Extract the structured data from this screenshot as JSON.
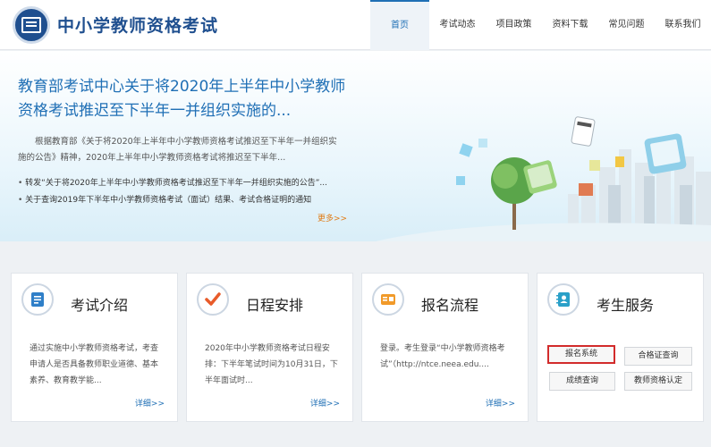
{
  "header": {
    "site_title": "中小学教师资格考试",
    "nav": [
      "首页",
      "考试动态",
      "项目政策",
      "资料下载",
      "常见问题",
      "联系我们"
    ]
  },
  "banner": {
    "headline": "教育部考试中心关于将2020年上半年中小学教师资格考试推迟至下半年一并组织实施的...",
    "summary": "根据教育部《关于将2020年上半年中小学教师资格考试推迟至下半年一并组织实施的公告》精神，2020年上半年中小学教师资格考试将推迟至下半年...",
    "news": [
      "转发“关于将2020年上半年中小学教师资格考试推迟至下半年一并组织实施的公告”...",
      "关于查询2019年下半年中小学教师资格考试（面试）结果、考试合格证明的通知"
    ],
    "more": "更多>>"
  },
  "cards": [
    {
      "title": "考试介绍",
      "text": "通过实施中小学教师资格考试，考查申请人是否具备教师职业道德、基本素养、教育教学能...",
      "more": "详细>>",
      "icon": "document-icon"
    },
    {
      "title": "日程安排",
      "text": "2020年中小学教师资格考试日程安排：下半年笔试时间为10月31日，下半年面试时...",
      "more": "详细>>",
      "icon": "checkmark-icon"
    },
    {
      "title": "报名流程",
      "text": "登录。考生登录“中小学教师资格考试”（http://ntce.neea.edu....",
      "more": "详细>>",
      "icon": "form-icon"
    },
    {
      "title": "考生服务",
      "icon": "contacts-icon",
      "buttons": [
        "报名系统",
        "合格证查询",
        "成绩查询",
        "教师资格认定"
      ]
    }
  ],
  "colors": {
    "brand": "#1f4f8f",
    "link": "#1f6fb5",
    "more": "#e07b16",
    "highlight": "#d22b2b"
  }
}
